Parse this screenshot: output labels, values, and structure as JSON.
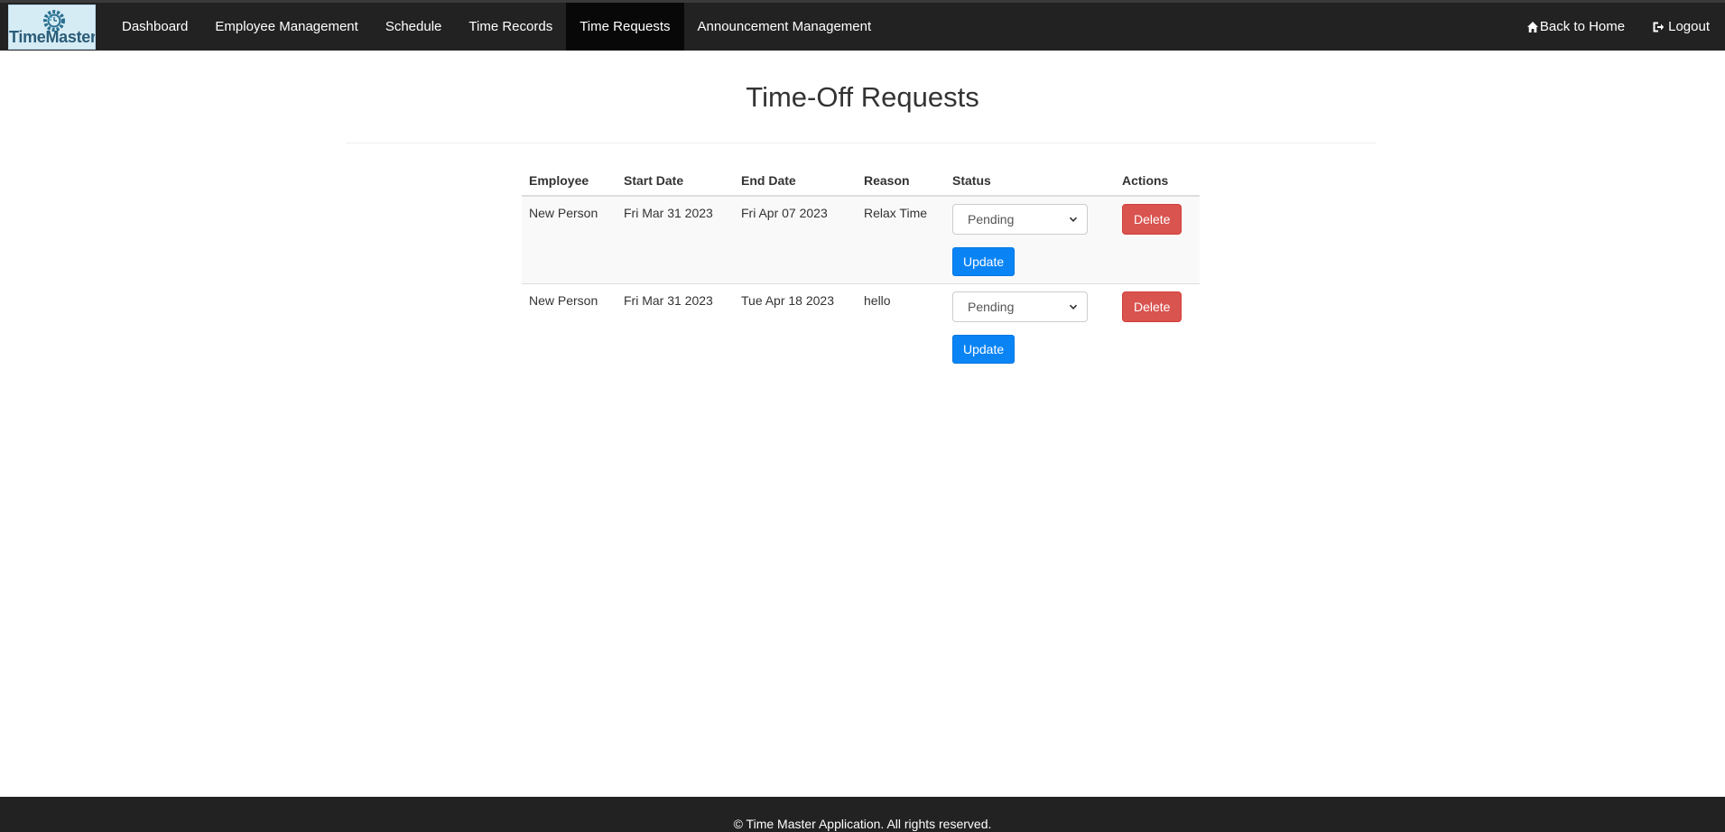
{
  "app": {
    "brand_text": "TimeMaster",
    "brand_icon": "gear-clock-icon"
  },
  "nav": {
    "items": [
      {
        "label": "Dashboard",
        "active": false
      },
      {
        "label": "Employee Management",
        "active": false
      },
      {
        "label": "Schedule",
        "active": false
      },
      {
        "label": "Time Records",
        "active": false
      },
      {
        "label": "Time Requests",
        "active": true
      },
      {
        "label": "Announcement Management",
        "active": false
      }
    ],
    "back_home": {
      "label": "Back to Home",
      "icon": "home-icon"
    },
    "logout": {
      "label": "Logout",
      "icon": "logout-icon"
    }
  },
  "main": {
    "title": "Time-Off Requests",
    "table": {
      "headers": [
        "Employee",
        "Start Date",
        "End Date",
        "Reason",
        "Status",
        "Actions"
      ],
      "rows": [
        {
          "employee": "New Person",
          "start_date": "Fri Mar 31 2023",
          "end_date": "Fri Apr 07 2023",
          "reason": "Relax Time",
          "status": "Pending",
          "update_label": "Update",
          "delete_label": "Delete"
        },
        {
          "employee": "New Person",
          "start_date": "Fri Mar 31 2023",
          "end_date": "Tue Apr 18 2023",
          "reason": "hello",
          "status": "Pending",
          "update_label": "Update",
          "delete_label": "Delete"
        }
      ]
    }
  },
  "footer": {
    "text": "© Time Master Application. All rights reserved."
  },
  "colors": {
    "navbar_bg": "#222222",
    "nav_active_bg": "#080808",
    "update_button": "#0a84f5",
    "delete_button": "#d9534f",
    "footer_bg": "#222222"
  }
}
